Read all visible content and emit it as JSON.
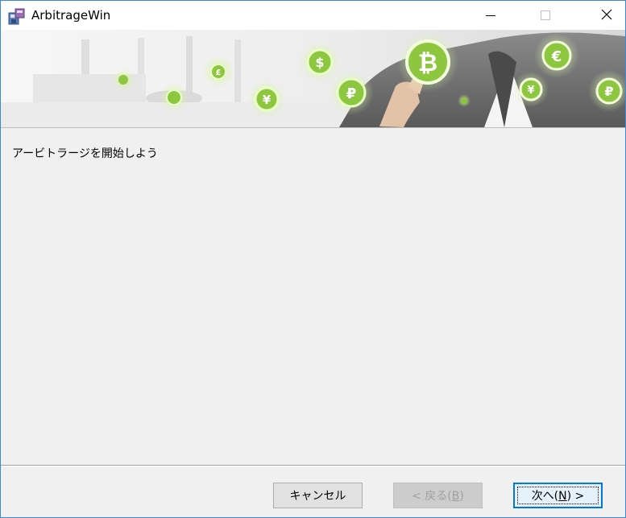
{
  "window": {
    "title": "ArbitrageWin",
    "controls": {
      "minimize": "minimize",
      "maximize": "maximize",
      "close": "close"
    }
  },
  "banner": {
    "symbols": [
      "$",
      "₿",
      "€",
      "¥",
      "₽",
      "£",
      "¥",
      "₽"
    ],
    "accent_color": "#8dc63f"
  },
  "content": {
    "heading": "アービトラージを開始しよう"
  },
  "buttons": {
    "cancel": {
      "label": "キャンセル"
    },
    "back": {
      "prefix": "< 戻る(",
      "key": "B",
      "suffix": ")"
    },
    "next": {
      "prefix": "次へ(",
      "key": "N",
      "suffix": ") >"
    }
  }
}
